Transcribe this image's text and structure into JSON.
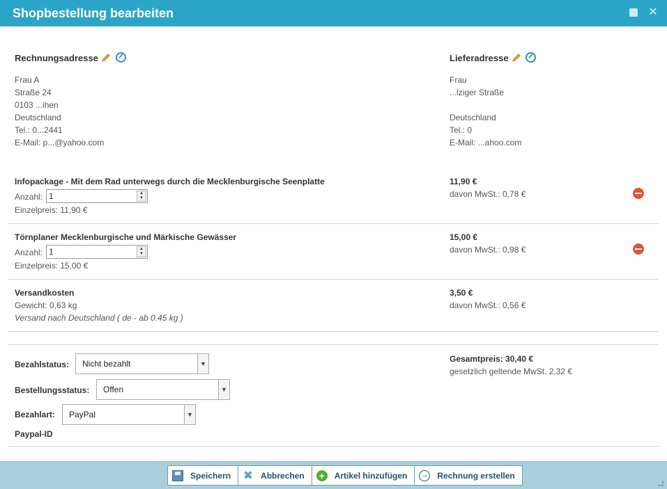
{
  "window": {
    "title": "Shopbestellung bearbeiten"
  },
  "billing": {
    "heading": "Rechnungsadresse",
    "lines": [
      "Frau A",
      "Straße 24",
      "0103 ...ihen",
      "Deutschland",
      "Tel.: 0...2441",
      "E-Mail: p...@yahoo.com"
    ]
  },
  "shipping": {
    "heading": "Lieferadresse",
    "lines": [
      "Frau",
      "...lziger Straße",
      "",
      "Deutschland",
      "Tel.: 0",
      "E-Mail: ...ahoo.com"
    ]
  },
  "items": [
    {
      "title": "Infopackage - Mit dem Rad unterwegs durch die Mecklenburgische Seenplatte",
      "qty_label": "Anzahl:",
      "qty": "1",
      "unit_price": "Einzelpreis: 11,90 €",
      "price": "11,90 €",
      "vat": "davon MwSt.: 0,78 €"
    },
    {
      "title": "Törnplaner Mecklenburgische und Märkische Gewässer",
      "qty_label": "Anzahl:",
      "qty": "1",
      "unit_price": "Einzelpreis: 15,00 €",
      "price": "15,00 €",
      "vat": "davon MwSt.: 0,98 €"
    }
  ],
  "shipping_cost": {
    "title": "Versandkosten",
    "weight": "Gewicht: 0,63 kg",
    "method": "Versand nach Deutschland ( de - ab 0.45 kg )",
    "price": "3,50 €",
    "vat": "davon MwSt.: 0,56 €"
  },
  "status": {
    "payment_status_label": "Bezahlstatus:",
    "payment_status_value": "Nicht bezahlt",
    "order_status_label": "Bestellungsstatus:",
    "order_status_value": "Offen",
    "payment_method_label": "Bezahlart:",
    "payment_method_value": "PayPal",
    "paypal_id_label": "Paypal-ID"
  },
  "total": {
    "label": "Gesamtpreis: 30,40 €",
    "vat": "gesetzlich geltende MwSt. 2,32 €"
  },
  "footer": {
    "save": "Speichern",
    "cancel": "Abbrechen",
    "add_item": "Artikel hinzufügen",
    "create_invoice": "Rechnung erstellen"
  },
  "colors": {
    "titlebar": "#2aa5c7",
    "footer": "#a9d0dd",
    "delete": "#e0533e"
  }
}
